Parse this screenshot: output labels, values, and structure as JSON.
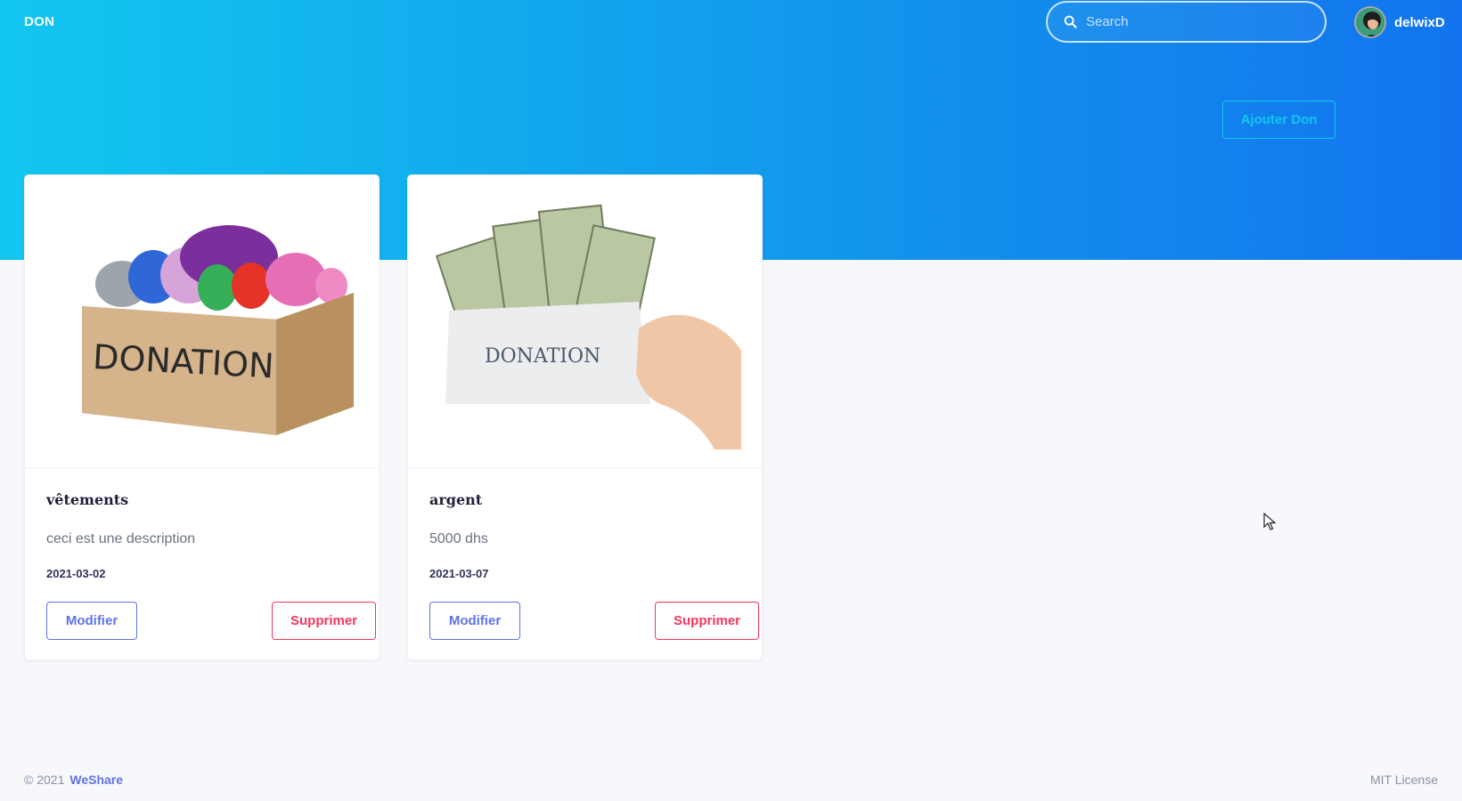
{
  "navbar": {
    "brand": "DON",
    "search_placeholder": "Search",
    "username": "delwixD"
  },
  "hero": {
    "add_button": "Ajouter Don"
  },
  "donations": [
    {
      "title": "vêtements",
      "description": "ceci est une description",
      "date": "2021-03-02",
      "image_label": "DONATION",
      "edit_label": "Modifier",
      "delete_label": "Supprimer"
    },
    {
      "title": "argent",
      "description": "5000 dhs",
      "date": "2021-03-07",
      "image_label": "DONATION",
      "edit_label": "Modifier",
      "delete_label": "Supprimer"
    }
  ],
  "footer": {
    "copyright": "© 2021",
    "brand_link": "WeShare",
    "license": "MIT License"
  },
  "colors": {
    "gradient_start": "#12c7ef",
    "gradient_end": "#1274ee",
    "primary": "#5e72e4",
    "danger": "#f5365c",
    "info": "#12c7ef"
  }
}
